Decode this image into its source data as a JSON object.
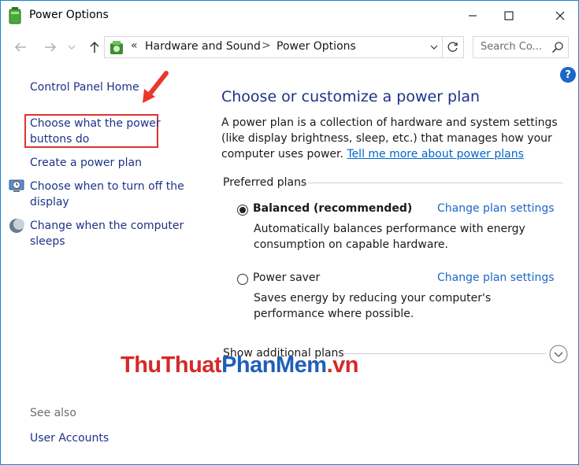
{
  "window": {
    "title": "Power Options"
  },
  "address": {
    "breadcrumb_prefix": "«",
    "crumbs": [
      "Hardware and Sound",
      "Power Options"
    ],
    "separator": ">",
    "search_placeholder": "Search Co..."
  },
  "help_label": "?",
  "sidebar": {
    "home": "Control Panel Home",
    "items": [
      {
        "label": "Choose what the power buttons do",
        "highlighted": true
      },
      {
        "label": "Create a power plan"
      },
      {
        "label": "Choose when to turn off the display",
        "icon": "display-clock-icon"
      },
      {
        "label": "Change when the computer sleeps",
        "icon": "moon-sleep-icon"
      }
    ],
    "see_also": "See also",
    "see_also_items": [
      {
        "label": "User Accounts"
      }
    ]
  },
  "main": {
    "heading": "Choose or customize a power plan",
    "description": "A power plan is a collection of hardware and system settings (like display brightness, sleep, etc.) that manages how your computer uses power.",
    "description_link": "Tell me more about power plans",
    "preferred_label": "Preferred plans",
    "plans": [
      {
        "name": "Balanced (recommended)",
        "selected": true,
        "change_label": "Change plan settings",
        "desc": "Automatically balances performance with energy consumption on capable hardware."
      },
      {
        "name": "Power saver",
        "selected": false,
        "change_label": "Change plan settings",
        "desc": "Saves energy by reducing your computer's performance where possible."
      }
    ],
    "show_additional": "Show additional plans"
  },
  "watermark": {
    "part1": "ThuThuat",
    "part2": "PhanMem",
    "part3": ".vn"
  },
  "colors": {
    "link": "#1e3287",
    "accent": "#1c67c7",
    "highlight": "#e0322f"
  }
}
